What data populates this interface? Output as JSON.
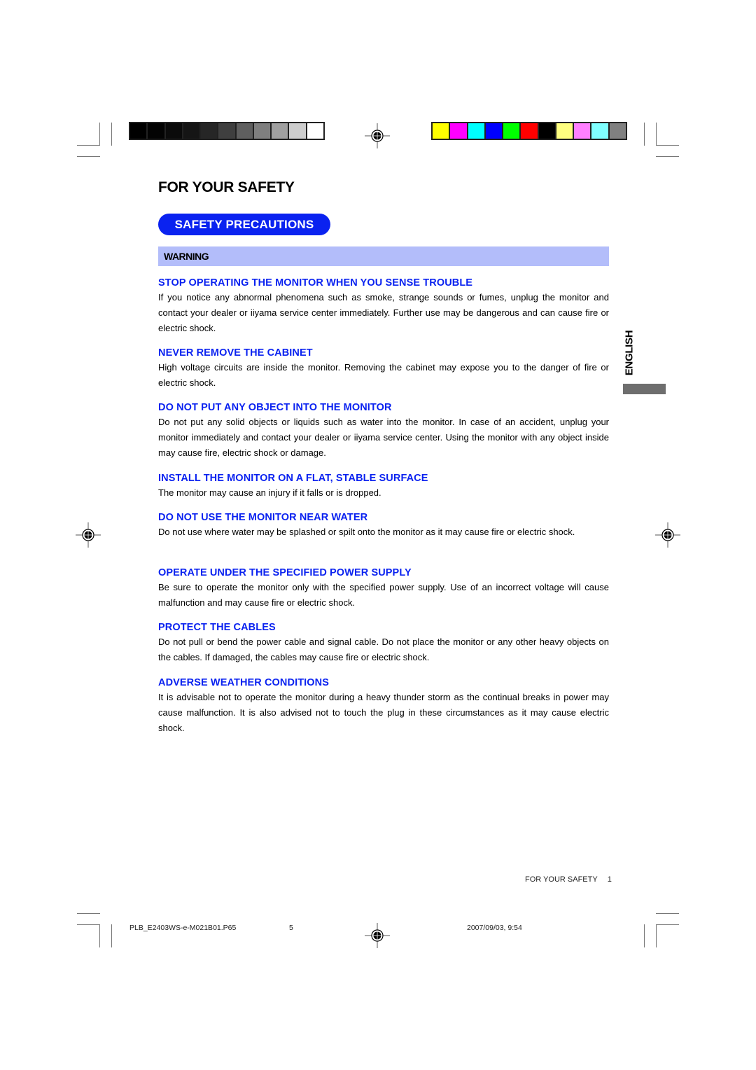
{
  "print_marks": {
    "grayscale_swatches": [
      "#000000",
      "#030303",
      "#0b0b0b",
      "#151515",
      "#262626",
      "#3f3f3f",
      "#5f5f5f",
      "#7f7f7f",
      "#a0a0a0",
      "#cdcdcd",
      "#ffffff"
    ],
    "color_swatches": [
      "#ffff00",
      "#ff00ff",
      "#00ffff",
      "#0000ff",
      "#00ff00",
      "#ff0000",
      "#000000",
      "#ffff80",
      "#ff80ff",
      "#80ffff",
      "#808080"
    ]
  },
  "page": {
    "title": "FOR YOUR SAFETY",
    "section_pill": "SAFETY PRECAUTIONS",
    "warning_label": "WARNING",
    "accent_color": "#0a22f0",
    "warning_bg": "#b3bdfa",
    "language_tab": "ENGLISH"
  },
  "sections": [
    {
      "heading": "STOP OPERATING THE MONITOR WHEN YOU SENSE TROUBLE",
      "body": "If you notice any abnormal phenomena such as smoke, strange sounds or fumes, unplug the monitor and contact your dealer or iiyama service center immediately. Further use may be dangerous and can cause fire or electric shock."
    },
    {
      "heading": "NEVER REMOVE THE CABINET",
      "body": "High voltage circuits are inside the monitor. Removing the cabinet may expose you to the danger of fire or electric shock."
    },
    {
      "heading": "DO NOT PUT ANY OBJECT INTO THE MONITOR",
      "body": "Do not put any solid objects or liquids such as water into the monitor. In case of an accident, unplug your monitor immediately and contact your dealer or iiyama service center. Using the monitor with any object inside may cause fire, electric shock or damage."
    },
    {
      "heading": "INSTALL THE MONITOR ON A FLAT, STABLE SURFACE",
      "body": "The monitor may cause an injury if it falls or is dropped."
    },
    {
      "heading": "DO NOT USE THE MONITOR NEAR WATER",
      "body": "Do not use where water may be splashed or spilt onto the monitor as it may cause fire or electric shock."
    },
    {
      "heading": "OPERATE UNDER THE SPECIFIED POWER SUPPLY",
      "body": "Be sure to operate the monitor only with the specified power supply. Use of an incorrect voltage will cause malfunction and may cause fire or electric shock."
    },
    {
      "heading": "PROTECT THE CABLES",
      "body": "Do not pull or bend the power cable and signal cable. Do not place the monitor or any other heavy objects on the cables. If damaged, the cables may cause fire or electric shock."
    },
    {
      "heading": "ADVERSE WEATHER CONDITIONS",
      "body": "It is advisable not to operate the monitor during a heavy thunder storm as the continual breaks in power may cause malfunction. It is also advised not to touch the plug in these circumstances as it may cause electric shock."
    }
  ],
  "footer": {
    "running_footer": "FOR YOUR SAFETY",
    "page_number": "1",
    "file_name": "PLB_E2403WS-e-M021B01.P65",
    "sheet_number": "5",
    "timestamp": "2007/09/03, 9:54"
  }
}
